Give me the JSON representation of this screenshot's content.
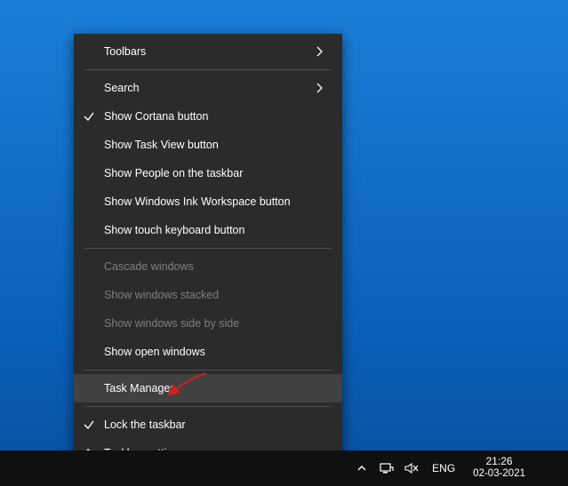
{
  "context_menu": {
    "items": [
      {
        "label": "Toolbars",
        "submenu": true
      },
      {
        "label": "Search",
        "submenu": true
      },
      {
        "label": "Show Cortana button",
        "checked": true
      },
      {
        "label": "Show Task View button"
      },
      {
        "label": "Show People on the taskbar"
      },
      {
        "label": "Show Windows Ink Workspace button"
      },
      {
        "label": "Show touch keyboard button"
      },
      {
        "label": "Cascade windows",
        "disabled": true
      },
      {
        "label": "Show windows stacked",
        "disabled": true
      },
      {
        "label": "Show windows side by side",
        "disabled": true
      },
      {
        "label": "Show open windows"
      },
      {
        "label": "Task Manager",
        "highlighted": true
      },
      {
        "label": "Lock the taskbar",
        "checked": true
      },
      {
        "label": "Taskbar settings",
        "icon": "gear"
      }
    ]
  },
  "taskbar": {
    "language": "ENG",
    "time": "21:26",
    "date": "02-03-2021"
  },
  "annotation": {
    "target": "Task Manager"
  }
}
